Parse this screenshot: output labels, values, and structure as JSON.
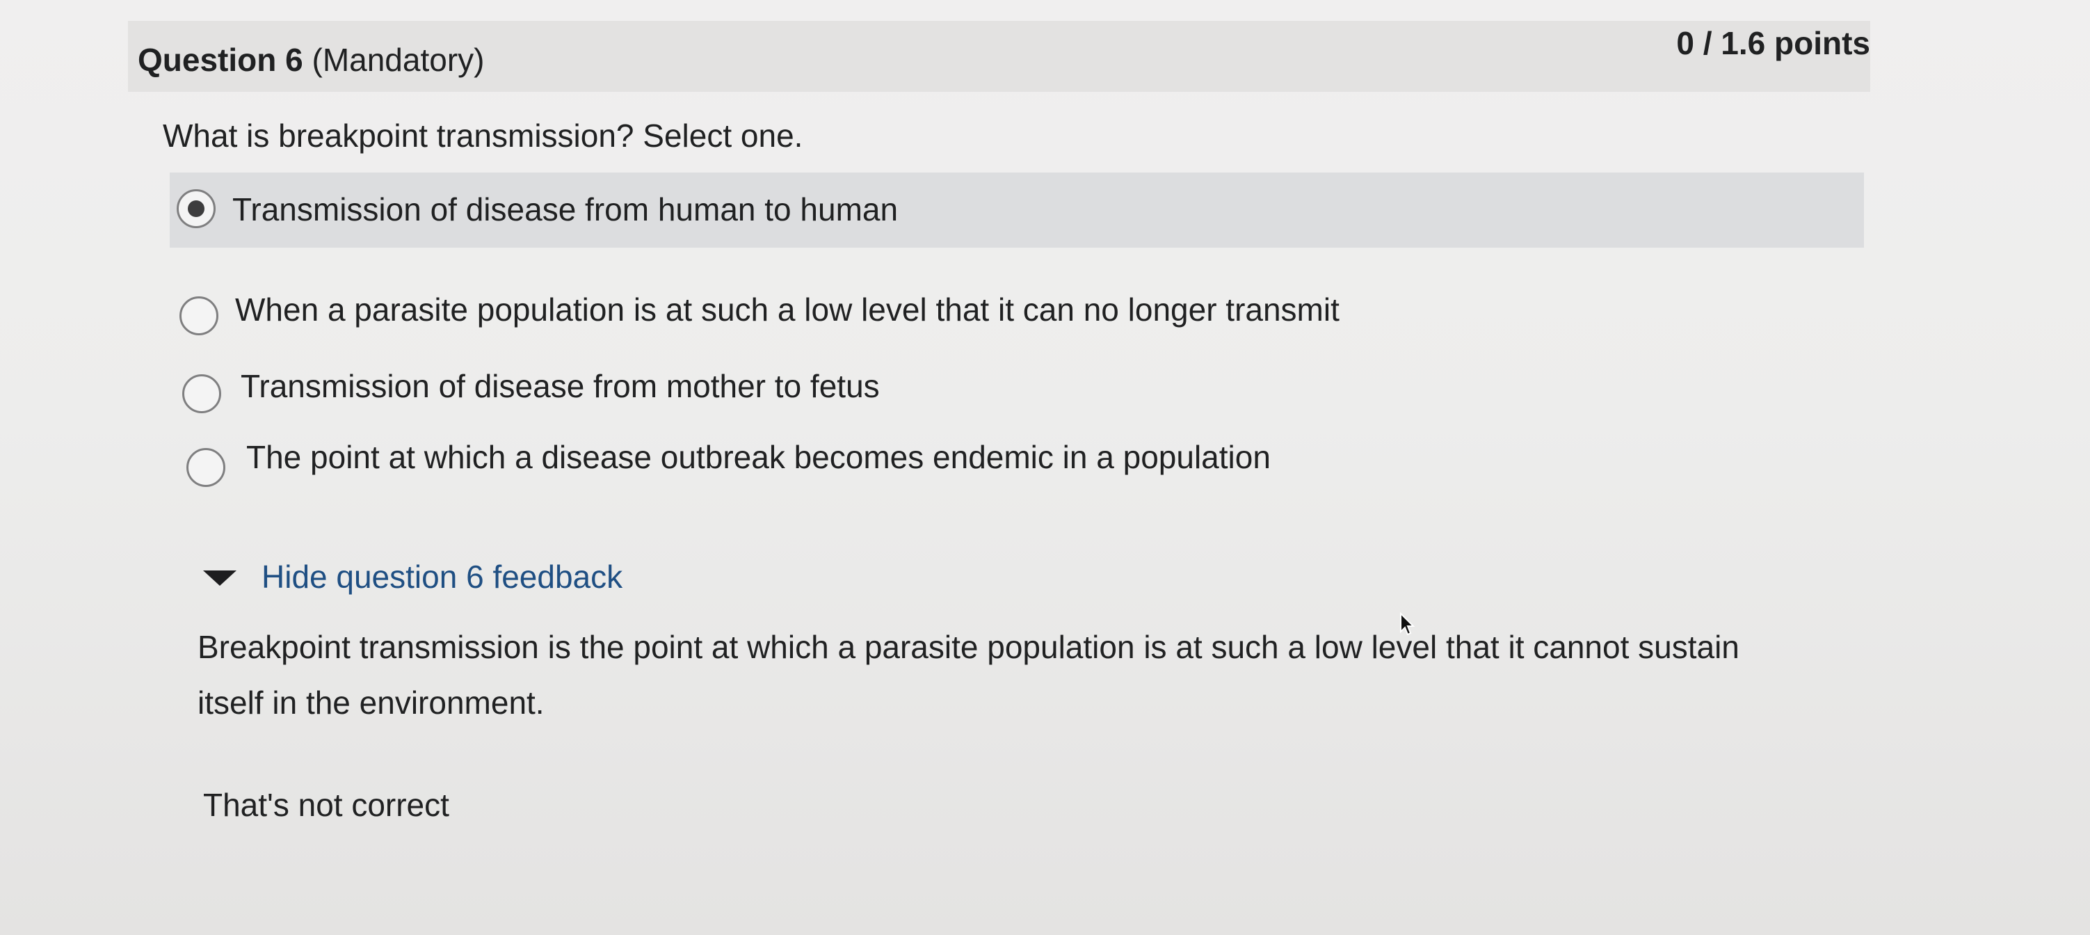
{
  "question": {
    "number_label": "Question 6",
    "qualifier": "(Mandatory)",
    "points": "0 / 1.6 points",
    "prompt": "What is breakpoint transmission? Select one."
  },
  "choices": [
    {
      "label": "Transmission of disease from human to human",
      "selected": true
    },
    {
      "label": "When a parasite population is at such a low level that it can no longer transmit",
      "selected": false
    },
    {
      "label": "Transmission of disease from mother to fetus",
      "selected": false
    },
    {
      "label": "The point at which a disease outbreak becomes endemic in a population",
      "selected": false
    }
  ],
  "feedback": {
    "toggle_label": "Hide question 6 feedback",
    "text": "Breakpoint transmission is the point at which a parasite population is at such a low level that it cannot sustain itself in the environment.",
    "status": "That's not correct"
  },
  "icons": {
    "toggle": "caret-down-icon",
    "cursor": "mouse-pointer-icon"
  },
  "colors": {
    "header_bg": "#e3e2e1",
    "selected_bg": "#dcdddf",
    "link": "#1f4f83"
  }
}
